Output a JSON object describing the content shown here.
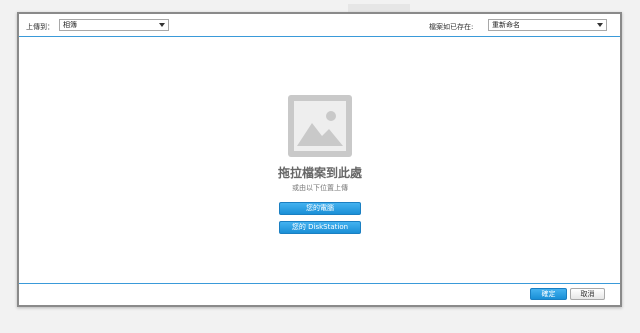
{
  "header": {
    "upload_to_label": "上傳到：",
    "upload_to_value": "相簿",
    "if_exists_label": "檔案如已存在:",
    "if_exists_value": "重新命名"
  },
  "dropzone": {
    "title": "拖拉檔案到此處",
    "subtitle": "或由以下位置上傳",
    "btn_computer": "您的電腦",
    "btn_diskstation": "您的 DiskStation"
  },
  "footer": {
    "ok_label": "確定",
    "cancel_label": "取消"
  },
  "icons": {
    "dropdown": "chevron-down-icon",
    "placeholder": "image-placeholder-icon"
  },
  "colors": {
    "accent": "#1a8fd6",
    "divider": "#3a9ad9"
  }
}
